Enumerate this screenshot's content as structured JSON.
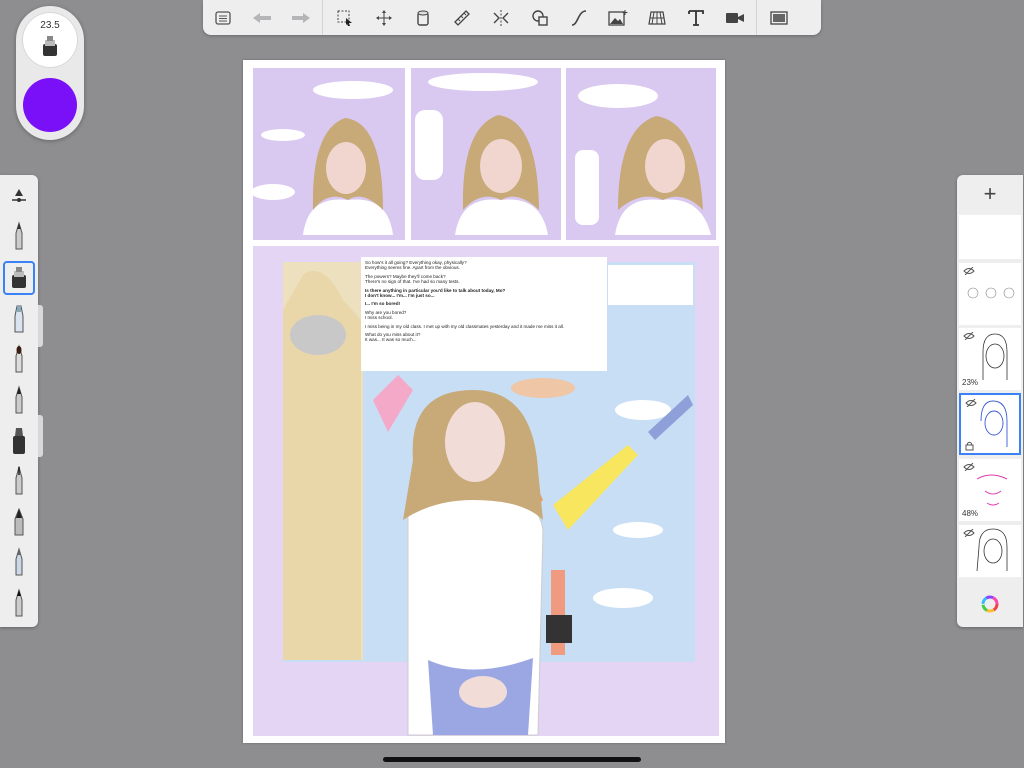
{
  "toolbar": {
    "items": [
      "list-icon",
      "undo-icon",
      "redo-icon",
      "selection-icon",
      "transform-icon",
      "fill-icon",
      "ruler-icon",
      "symmetry-icon",
      "shapes-icon",
      "curve-icon",
      "image-icon",
      "perspective-icon",
      "text-icon",
      "video-icon",
      "fullscreen-icon"
    ]
  },
  "brush": {
    "size": "23.5",
    "color": "#7a10f7"
  },
  "brushes": [
    "pencil",
    "airbrush-selected",
    "marker",
    "brush",
    "pen",
    "inking",
    "fine-pen",
    "fountain-pen",
    "chalk",
    "charcoal"
  ],
  "dialog": {
    "lines": [
      "So how's it all going? Everything okay, physically?",
      "Everything seems fine. Apart from the obvious.",
      "The powers? Maybe they'll come back?",
      "There's no sign of that. I've had so many tests.",
      "Is there anything in particular you'd like to talk about today, Mo?",
      "I don't know... I'm... I'm just so...",
      "I... I'm so bored!",
      "Why are you bored?",
      "I miss school.",
      "I miss being in my old class. I met up with my old classmates yesterday and it made me miss it all.",
      "What do you miss about it?",
      "It was... It was so much..."
    ]
  },
  "layers": {
    "add_label": "+",
    "items": [
      {
        "name": "blank",
        "pct": ""
      },
      {
        "name": "three-faces",
        "pct": ""
      },
      {
        "name": "girl-sketch",
        "pct": "23%"
      },
      {
        "name": "blue-girl",
        "pct": ""
      },
      {
        "name": "pink-face",
        "pct": "48%"
      },
      {
        "name": "girl-line",
        "pct": ""
      }
    ]
  }
}
